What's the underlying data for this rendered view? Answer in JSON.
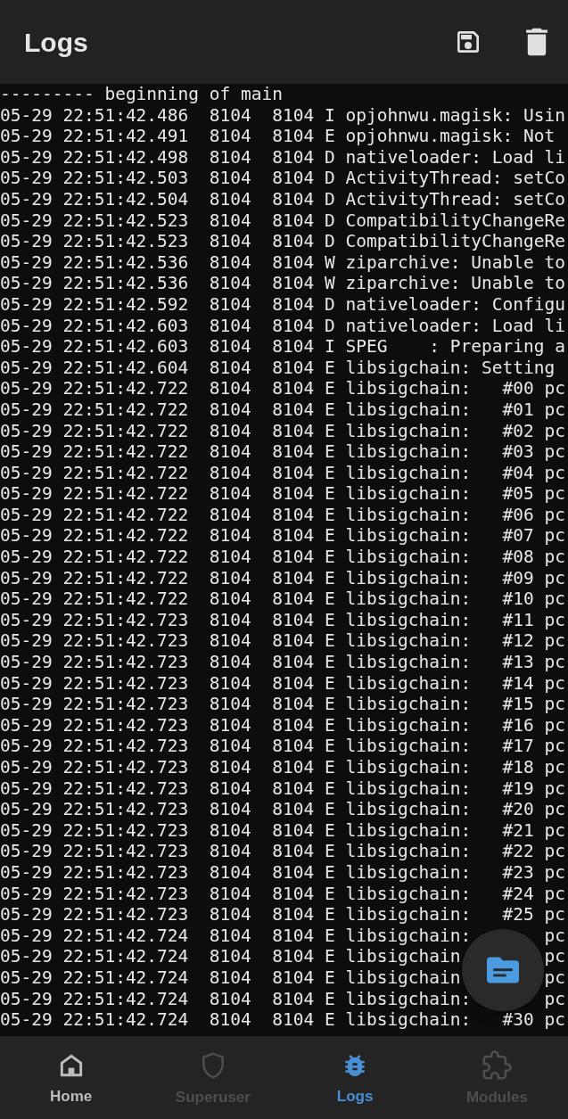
{
  "app_bar": {
    "title": "Logs",
    "actions": [
      {
        "kind": "save"
      },
      {
        "kind": "delete"
      }
    ]
  },
  "log_lines": [
    "--------- beginning of main",
    "05-29 22:51:42.486  8104  8104 I opjohnwu.magisk: Usin",
    "05-29 22:51:42.491  8104  8104 E opjohnwu.magisk: Not",
    "05-29 22:51:42.498  8104  8104 D nativeloader: Load li",
    "05-29 22:51:42.503  8104  8104 D ActivityThread: setCo",
    "05-29 22:51:42.504  8104  8104 D ActivityThread: setCo",
    "05-29 22:51:42.523  8104  8104 D CompatibilityChangeRe",
    "05-29 22:51:42.523  8104  8104 D CompatibilityChangeRe",
    "05-29 22:51:42.536  8104  8104 W ziparchive: Unable to",
    "05-29 22:51:42.536  8104  8104 W ziparchive: Unable to",
    "05-29 22:51:42.592  8104  8104 D nativeloader: Configu",
    "05-29 22:51:42.603  8104  8104 D nativeloader: Load li",
    "05-29 22:51:42.603  8104  8104 I SPEG    : Preparing a",
    "05-29 22:51:42.604  8104  8104 E libsigchain: Setting",
    "05-29 22:51:42.722  8104  8104 E libsigchain:   #00 pc",
    "05-29 22:51:42.722  8104  8104 E libsigchain:   #01 pc",
    "05-29 22:51:42.722  8104  8104 E libsigchain:   #02 pc",
    "05-29 22:51:42.722  8104  8104 E libsigchain:   #03 pc",
    "05-29 22:51:42.722  8104  8104 E libsigchain:   #04 pc",
    "05-29 22:51:42.722  8104  8104 E libsigchain:   #05 pc",
    "05-29 22:51:42.722  8104  8104 E libsigchain:   #06 pc",
    "05-29 22:51:42.722  8104  8104 E libsigchain:   #07 pc",
    "05-29 22:51:42.722  8104  8104 E libsigchain:   #08 pc",
    "05-29 22:51:42.722  8104  8104 E libsigchain:   #09 pc",
    "05-29 22:51:42.722  8104  8104 E libsigchain:   #10 pc",
    "05-29 22:51:42.723  8104  8104 E libsigchain:   #11 pc",
    "05-29 22:51:42.723  8104  8104 E libsigchain:   #12 pc",
    "05-29 22:51:42.723  8104  8104 E libsigchain:   #13 pc",
    "05-29 22:51:42.723  8104  8104 E libsigchain:   #14 pc",
    "05-29 22:51:42.723  8104  8104 E libsigchain:   #15 pc",
    "05-29 22:51:42.723  8104  8104 E libsigchain:   #16 pc",
    "05-29 22:51:42.723  8104  8104 E libsigchain:   #17 pc",
    "05-29 22:51:42.723  8104  8104 E libsigchain:   #18 pc",
    "05-29 22:51:42.723  8104  8104 E libsigchain:   #19 pc",
    "05-29 22:51:42.723  8104  8104 E libsigchain:   #20 pc",
    "05-29 22:51:42.723  8104  8104 E libsigchain:   #21 pc",
    "05-29 22:51:42.723  8104  8104 E libsigchain:   #22 pc",
    "05-29 22:51:42.723  8104  8104 E libsigchain:   #23 pc",
    "05-29 22:51:42.723  8104  8104 E libsigchain:   #24 pc",
    "05-29 22:51:42.723  8104  8104 E libsigchain:   #25 pc",
    "05-29 22:51:42.724  8104  8104 E libsigchain:       pc",
    "05-29 22:51:42.724  8104  8104 E libsigchain        pc",
    "05-29 22:51:42.724  8104  8104 E libsigchain        pc",
    "05-29 22:51:42.724  8104  8104 E libsigchain:       pc",
    "05-29 22:51:42.724  8104  8104 E libsigchain:   #30 pc"
  ],
  "fab": {
    "kind": "logs"
  },
  "nav": [
    {
      "kind": "home",
      "label": "Home",
      "selected": false,
      "disabled": false
    },
    {
      "kind": "shield",
      "label": "Superuser",
      "selected": false,
      "disabled": true
    },
    {
      "kind": "bug",
      "label": "Logs",
      "selected": true,
      "disabled": false
    },
    {
      "kind": "puzzle",
      "label": "Modules",
      "selected": false,
      "disabled": true
    }
  ]
}
